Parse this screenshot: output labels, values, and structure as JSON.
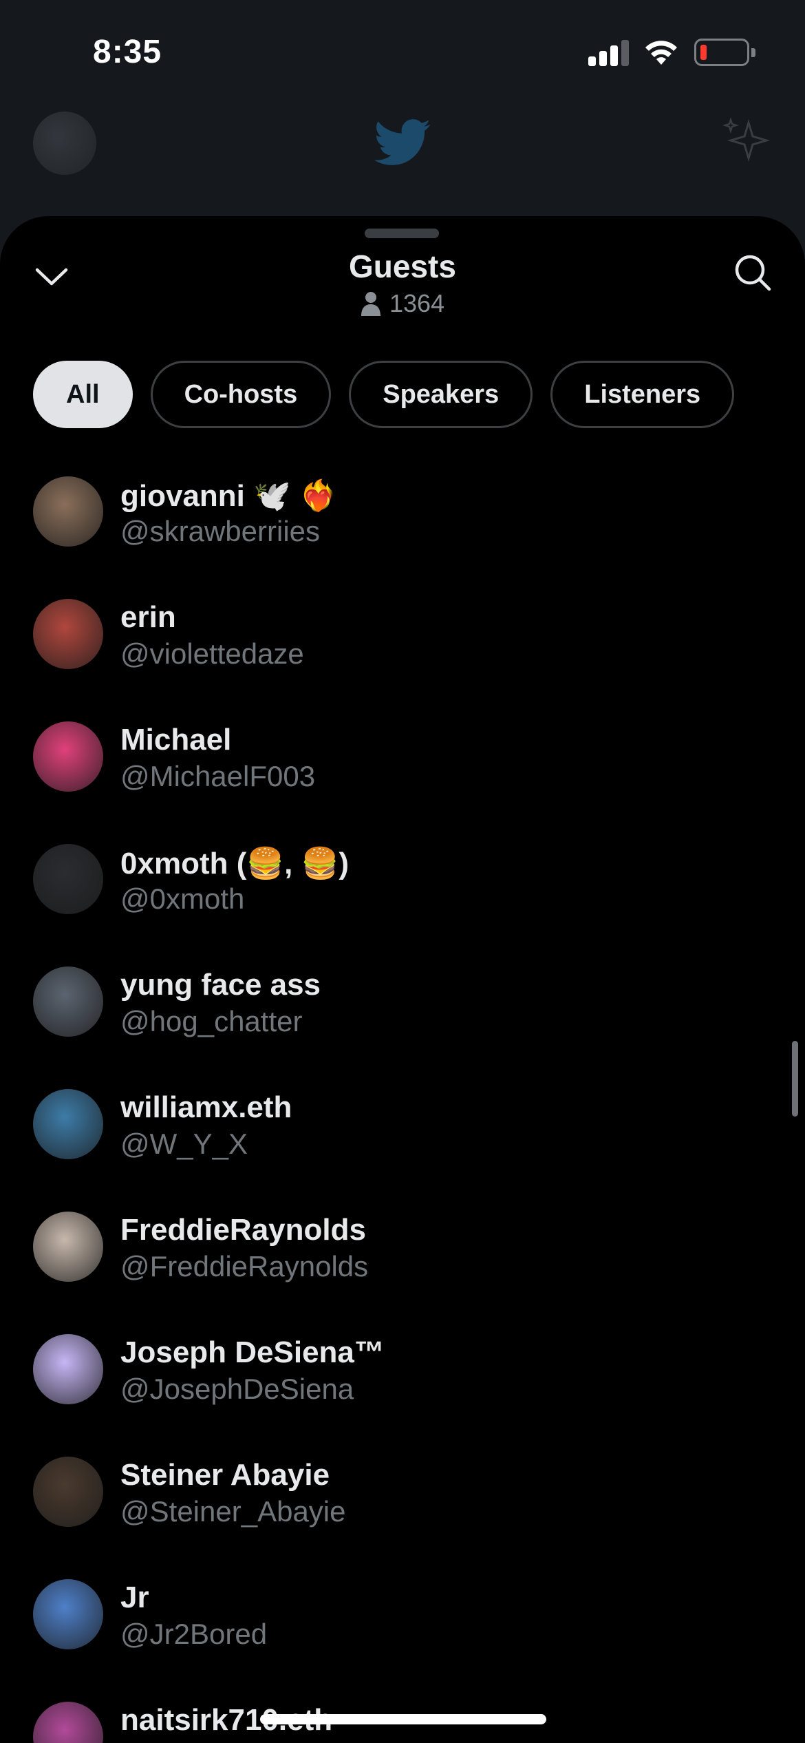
{
  "status": {
    "time": "8:35"
  },
  "header": {
    "title": "Guests",
    "count": "1364"
  },
  "tabs": [
    "All",
    "Co-hosts",
    "Speakers",
    "Listeners"
  ],
  "guests": [
    {
      "name": "giovanni 🕊️ ❤️‍🔥",
      "handle": "@skrawberriies",
      "avatar_color": "#8a6f5a"
    },
    {
      "name": "erin",
      "handle": "@violettedaze",
      "avatar_color": "#b0473d"
    },
    {
      "name": "Michael",
      "handle": "@MichaelF003",
      "avatar_color": "#e0417a"
    },
    {
      "name": "0xmoth (🍔, 🍔)",
      "handle": "@0xmoth",
      "avatar_color": "#2a2c30"
    },
    {
      "name": "yung face ass",
      "handle": "@hog_chatter",
      "avatar_color": "#5b6470"
    },
    {
      "name": "williamx.eth",
      "handle": "@W_Y_X",
      "avatar_color": "#3d7ca8"
    },
    {
      "name": "FreddieRaynolds",
      "handle": "@FreddieRaynolds",
      "avatar_color": "#c7b8ac"
    },
    {
      "name": "Joseph DeSiena™",
      "handle": "@JosephDeSiena",
      "avatar_color": "#c6b6f5"
    },
    {
      "name": "Steiner Abayie",
      "handle": "@Steiner_Abayie",
      "avatar_color": "#4a3a2e"
    },
    {
      "name": "Jr",
      "handle": "@Jr2Bored",
      "avatar_color": "#4e80c9"
    },
    {
      "name": "naitsirk710.eth",
      "handle": "",
      "avatar_color": "#b24a9a"
    }
  ],
  "colors": {
    "sheet_background": "#000000",
    "active_tab": "#e1e3e6",
    "handle_text": "#71767b"
  }
}
